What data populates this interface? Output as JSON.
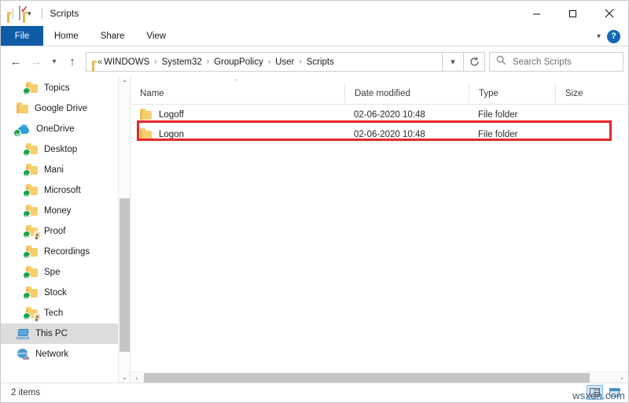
{
  "window": {
    "title": "Scripts",
    "quick_access": [
      {
        "name": "folder-icon",
        "label": "Explorer"
      },
      {
        "name": "properties-icon",
        "label": "Properties"
      },
      {
        "name": "new-folder-icon",
        "label": "New folder"
      },
      {
        "name": "customize-chevron-icon",
        "label": "Customize Quick Access Toolbar"
      }
    ],
    "controls": {
      "minimize": "Minimize",
      "maximize": "Maximize",
      "close": "Close"
    }
  },
  "ribbon": {
    "tabs": [
      {
        "label": "File",
        "active": true
      },
      {
        "label": "Home",
        "active": false
      },
      {
        "label": "Share",
        "active": false
      },
      {
        "label": "View",
        "active": false
      }
    ],
    "collapse_label": "Minimize the Ribbon",
    "help_label": "?"
  },
  "address": {
    "back_label": "Back",
    "forward_label": "Forward",
    "recent_label": "Recent locations",
    "up_label": "Up",
    "leading_chevron": "«",
    "crumbs": [
      "WINDOWS",
      "System32",
      "GroupPolicy",
      "User",
      "Scripts"
    ],
    "separator": "›",
    "dropdown_label": "Previous locations",
    "refresh_label": "Refresh",
    "search_placeholder": "Search Scripts"
  },
  "sidebar": {
    "items": [
      {
        "label": "Topics",
        "icon": "folder-sync-icon",
        "indent": true,
        "selected": false
      },
      {
        "label": "Google Drive",
        "icon": "folder-icon",
        "indent": false,
        "selected": false
      },
      {
        "label": "OneDrive",
        "icon": "onedrive-cloud-icon",
        "indent": false,
        "selected": false
      },
      {
        "label": "Desktop",
        "icon": "folder-sync-icon",
        "indent": true,
        "selected": false
      },
      {
        "label": "Mani",
        "icon": "folder-sync-icon",
        "indent": true,
        "selected": false
      },
      {
        "label": "Microsoft",
        "icon": "folder-sync-icon",
        "indent": true,
        "selected": false
      },
      {
        "label": "Money",
        "icon": "folder-sync-icon",
        "indent": true,
        "selected": false
      },
      {
        "label": "Proof",
        "icon": "folder-shared-sync-icon",
        "indent": true,
        "selected": false
      },
      {
        "label": "Recordings",
        "icon": "folder-sync-icon",
        "indent": true,
        "selected": false
      },
      {
        "label": "Spe",
        "icon": "folder-sync-icon",
        "indent": true,
        "selected": false
      },
      {
        "label": "Stock",
        "icon": "folder-sync-icon",
        "indent": true,
        "selected": false
      },
      {
        "label": "Tech",
        "icon": "folder-shared-sync-icon",
        "indent": true,
        "selected": false
      },
      {
        "label": "This PC",
        "icon": "this-pc-icon",
        "indent": false,
        "selected": true
      },
      {
        "label": "Network",
        "icon": "network-icon",
        "indent": false,
        "selected": false
      }
    ],
    "scroll_up_label": "⌃",
    "scroll_down_label": "⌄"
  },
  "filelist": {
    "columns": [
      {
        "label": "Name",
        "key": "name"
      },
      {
        "label": "Date modified",
        "key": "date"
      },
      {
        "label": "Type",
        "key": "type"
      },
      {
        "label": "Size",
        "key": "size"
      }
    ],
    "sort_indicator": "⌃",
    "rows": [
      {
        "name": "Logoff",
        "date": "02-06-2020 10:48",
        "type": "File folder",
        "size": "",
        "icon": "folder-icon",
        "highlighted": false
      },
      {
        "name": "Logon",
        "date": "02-06-2020 10:48",
        "type": "File folder",
        "size": "",
        "icon": "folder-icon",
        "highlighted": true
      }
    ],
    "scroll_left_label": "‹",
    "scroll_right_label": "›"
  },
  "statusbar": {
    "item_count": "2 items",
    "view_details_label": "Details view",
    "view_icons_label": "Large icons view"
  },
  "watermark": "wsxdn.com",
  "colors": {
    "accent_blue": "#0f5ba7",
    "annotation_red": "#e8262a",
    "folder_yellow": "#f7ce6e",
    "sync_green": "#1aa34a",
    "selection_gray": "#dcdcdc"
  }
}
